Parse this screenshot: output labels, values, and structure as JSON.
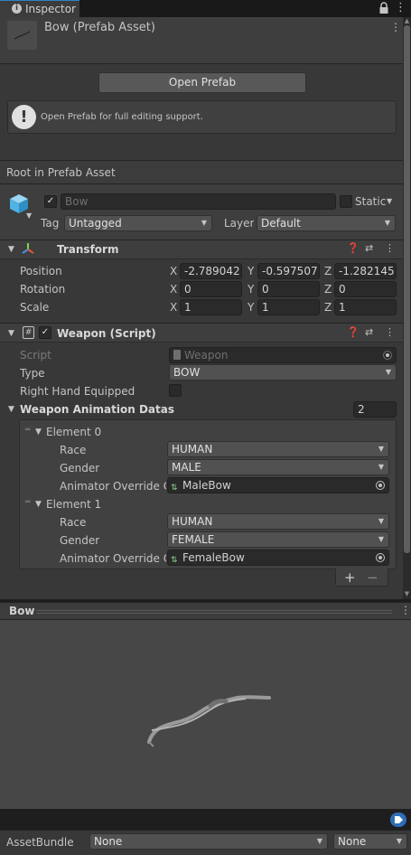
{
  "window": {
    "tab_label": "Inspector"
  },
  "header": {
    "title": "Bow (Prefab Asset)"
  },
  "open_prefab": {
    "button_label": "Open Prefab",
    "help_text": "Open Prefab for full editing support."
  },
  "root_label": "Root in Prefab Asset",
  "gameobject": {
    "name": "Bow",
    "static_label": "Static",
    "tag_label": "Tag",
    "tag_value": "Untagged",
    "layer_label": "Layer",
    "layer_value": "Default"
  },
  "transform": {
    "title": "Transform",
    "rows": [
      {
        "label": "Position",
        "x": "-2.789042",
        "y": "-0.597507",
        "z": "-1.282145"
      },
      {
        "label": "Rotation",
        "x": "0",
        "y": "0",
        "z": "0"
      },
      {
        "label": "Scale",
        "x": "1",
        "y": "1",
        "z": "1"
      }
    ],
    "axis_x": "X",
    "axis_y": "Y",
    "axis_z": "Z"
  },
  "weapon": {
    "title": "Weapon (Script)",
    "script_label": "Script",
    "script_value": "Weapon",
    "type_label": "Type",
    "type_value": "BOW",
    "right_hand_label": "Right Hand Equipped",
    "datas_label": "Weapon Animation Datas",
    "datas_count": "2",
    "elements": [
      {
        "label": "Element 0",
        "race_label": "Race",
        "race": "HUMAN",
        "gender_label": "Gender",
        "gender": "MALE",
        "override_label": "Animator Override Co",
        "override": "MaleBow"
      },
      {
        "label": "Element 1",
        "race_label": "Race",
        "race": "HUMAN",
        "gender_label": "Gender",
        "gender": "FEMALE",
        "override_label": "Animator Override Co",
        "override": "FemaleBow"
      }
    ],
    "add_label": "+",
    "remove_label": "−"
  },
  "preview": {
    "title": "Bow"
  },
  "assetbundle": {
    "label": "AssetBundle",
    "name_value": "None",
    "variant_value": "None"
  },
  "icons": [
    "info-icon",
    "lock-icon",
    "more-icon",
    "warning-icon",
    "cube-icon",
    "transform-icon",
    "help-icon",
    "settings-icon",
    "script-icon",
    "object-picker-icon",
    "tag-icon"
  ]
}
